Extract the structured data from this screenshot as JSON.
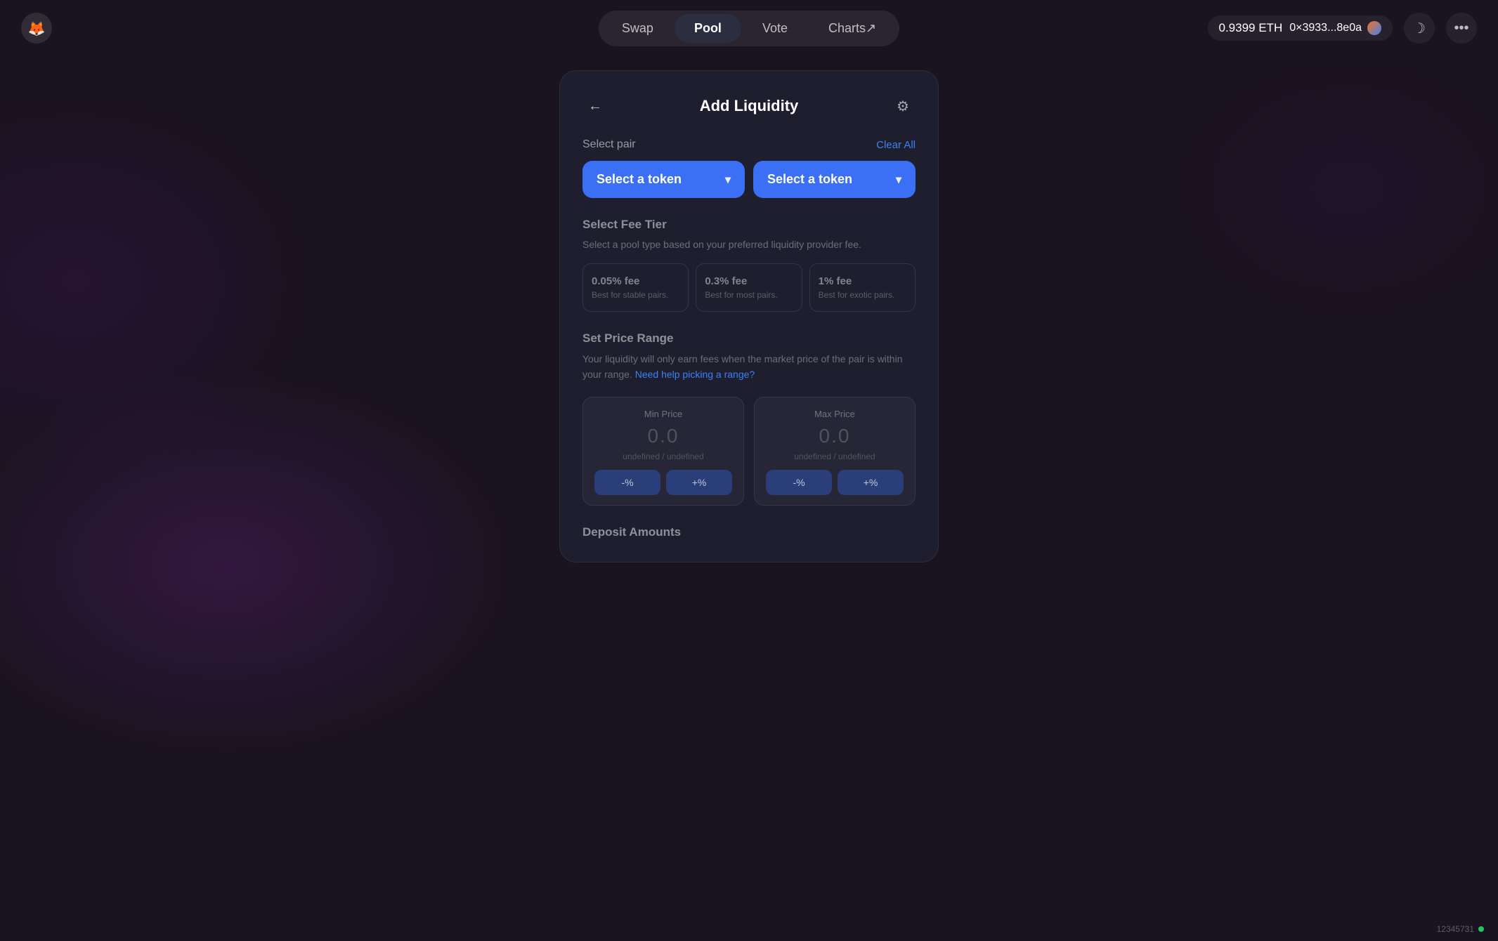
{
  "app": {
    "logo_alt": "App Logo"
  },
  "nav": {
    "tabs": [
      {
        "id": "swap",
        "label": "Swap",
        "active": false
      },
      {
        "id": "pool",
        "label": "Pool",
        "active": true
      },
      {
        "id": "vote",
        "label": "Vote",
        "active": false
      },
      {
        "id": "charts",
        "label": "Charts↗",
        "active": false
      }
    ],
    "wallet": {
      "balance": "0.9399 ETH",
      "address": "0×3933...8e0a"
    },
    "theme_toggle_icon": "☽",
    "more_icon": "•••"
  },
  "card": {
    "title": "Add Liquidity",
    "back_label": "←",
    "settings_label": "⚙"
  },
  "select_pair": {
    "label": "Select pair",
    "clear_all": "Clear All",
    "token1_placeholder": "Select a token",
    "token2_placeholder": "Select a token"
  },
  "fee_tier": {
    "title": "Select Fee Tier",
    "description": "Select a pool type based on your preferred liquidity provider fee.",
    "options": [
      {
        "id": "0.05",
        "title": "0.05% fee",
        "desc": "Best for stable pairs."
      },
      {
        "id": "0.3",
        "title": "0.3% fee",
        "desc": "Best for most pairs."
      },
      {
        "id": "1",
        "title": "1% fee",
        "desc": "Best for exotic pairs."
      }
    ]
  },
  "price_range": {
    "title": "Set Price Range",
    "description": "Your liquidity will only earn fees when the market price of the pair is within your range.",
    "help_link": "Need help picking a range?",
    "min_price": {
      "label": "Min Price",
      "value": "0.0",
      "pair": "undefined / undefined",
      "decrease_label": "-%",
      "increase_label": "+%"
    },
    "max_price": {
      "label": "Max Price",
      "value": "0.0",
      "pair": "undefined / undefined",
      "decrease_label": "-%",
      "increase_label": "+%"
    }
  },
  "deposit": {
    "title": "Deposit Amounts"
  },
  "status_bar": {
    "block_number": "12345731",
    "dot_color": "#22c55e"
  }
}
